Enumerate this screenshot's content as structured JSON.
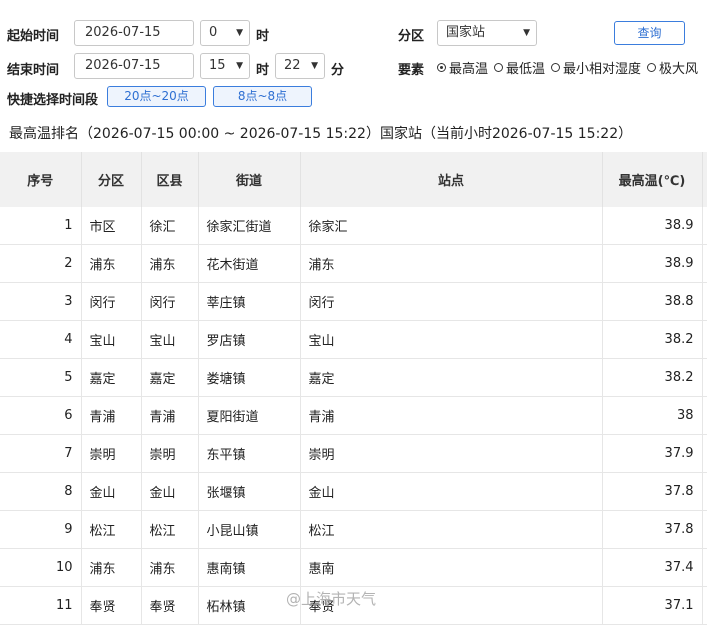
{
  "filters": {
    "start_label": "起始时间",
    "start_date": "2026-07-15",
    "start_hour": "0",
    "hour_unit": "时",
    "end_label": "结束时间",
    "end_date": "2026-07-15",
    "end_hour": "15",
    "end_minute": "22",
    "minute_unit": "分",
    "quick_label": "快捷选择时间段",
    "quick_1": "20点~20点",
    "quick_2": "8点~8点",
    "zone_label": "分区",
    "zone_value": "国家站",
    "query_button": "查询",
    "element_label": "要素",
    "elements": [
      {
        "label": "最高温",
        "selected": true
      },
      {
        "label": "最低温",
        "selected": false
      },
      {
        "label": "最小相对湿度",
        "selected": false
      },
      {
        "label": "极大风",
        "selected": false
      }
    ]
  },
  "summary": "最高温排名（2026-07-15 00:00 ~ 2026-07-15 15:22）国家站（当前小时2026-07-15 15:22）",
  "table": {
    "headers": [
      "序号",
      "分区",
      "区县",
      "街道",
      "站点",
      "最高温(℃)"
    ],
    "rows": [
      [
        "1",
        "市区",
        "徐汇",
        "徐家汇街道",
        "徐家汇",
        "38.9"
      ],
      [
        "2",
        "浦东",
        "浦东",
        "花木街道",
        "浦东",
        "38.9"
      ],
      [
        "3",
        "闵行",
        "闵行",
        "莘庄镇",
        "闵行",
        "38.8"
      ],
      [
        "4",
        "宝山",
        "宝山",
        "罗店镇",
        "宝山",
        "38.2"
      ],
      [
        "5",
        "嘉定",
        "嘉定",
        "娄塘镇",
        "嘉定",
        "38.2"
      ],
      [
        "6",
        "青浦",
        "青浦",
        "夏阳街道",
        "青浦",
        "38"
      ],
      [
        "7",
        "崇明",
        "崇明",
        "东平镇",
        "崇明",
        "37.9"
      ],
      [
        "8",
        "金山",
        "金山",
        "张堰镇",
        "金山",
        "37.8"
      ],
      [
        "9",
        "松江",
        "松江",
        "小昆山镇",
        "松江",
        "37.8"
      ],
      [
        "10",
        "浦东",
        "浦东",
        "惠南镇",
        "惠南",
        "37.4"
      ],
      [
        "11",
        "奉贤",
        "奉贤",
        "柘林镇",
        "奉贤",
        "37.1"
      ]
    ]
  },
  "watermark": "@上海市天气"
}
